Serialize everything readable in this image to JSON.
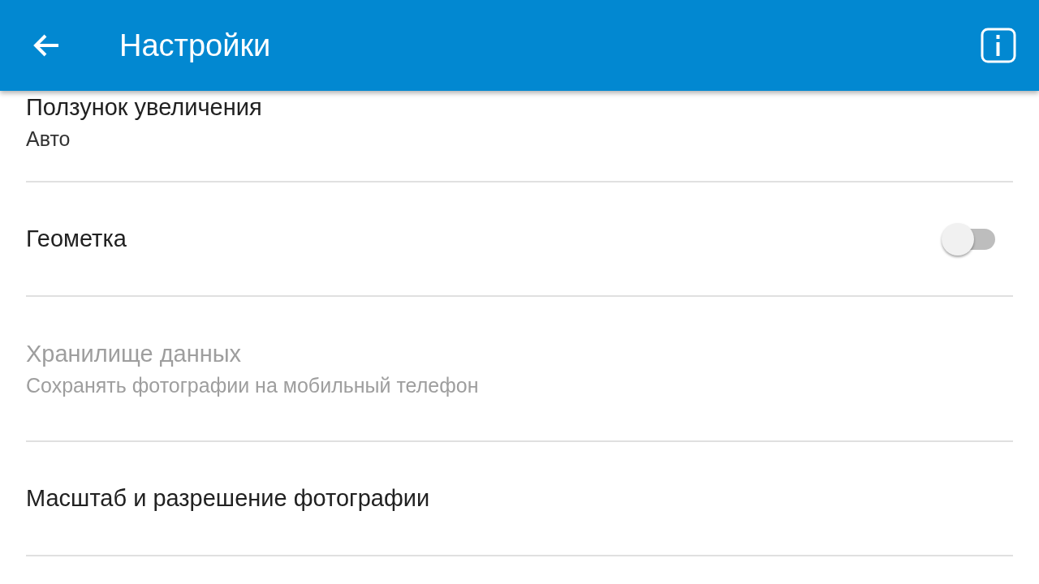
{
  "app_bar": {
    "title": "Настройки"
  },
  "settings": [
    {
      "kind": "text",
      "title": "Ползунок увеличения",
      "subtitle": "Авто",
      "disabled": false
    },
    {
      "kind": "switch",
      "title": "Геометка",
      "on": false,
      "disabled": false
    },
    {
      "kind": "text",
      "title": "Хранилище данных",
      "subtitle": "Сохранять фотографии на мобильный телефон",
      "disabled": true
    },
    {
      "kind": "text",
      "title": "Масштаб и разрешение фотографии",
      "disabled": false
    }
  ]
}
